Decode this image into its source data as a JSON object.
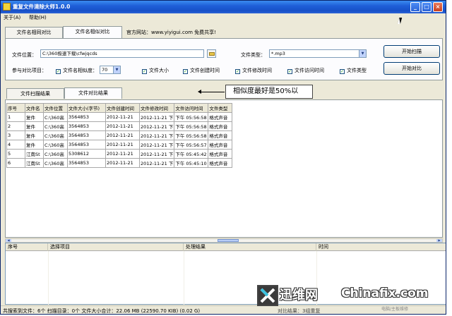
{
  "window": {
    "title": "重复文件清除大师1.0.0",
    "controls": {
      "minimize": "_",
      "maximize": "□",
      "close": "×"
    }
  },
  "menu": {
    "items": [
      "关于(A)",
      "帮助(H)"
    ]
  },
  "top_tabs": {
    "tabs": [
      "文件名相同对比",
      "文件名相似对比"
    ],
    "active_index": 1
  },
  "website": "官方网站：www.yiyigui.com 免费共享!",
  "form": {
    "location_label": "文件位置：",
    "location_value": "C:\\360极速下载\\cfwjqcds",
    "type_label": "文件类型：",
    "type_value": "*.mp3",
    "options_label": "参与对比项目：",
    "similarity_label": "文件名相似度：",
    "similarity_value": "70",
    "checkboxes": [
      "文件大小",
      "文件创建时间",
      "文件修改时间",
      "文件访问时间",
      "文件类型"
    ]
  },
  "buttons": {
    "scan": "开始扫描",
    "compare": "开始对比"
  },
  "result_tabs": {
    "tabs": [
      "文件扫描结果",
      "文件对比结果"
    ],
    "active_index": 1
  },
  "callout": "相似度最好是50%以",
  "table": {
    "headers": [
      "序号",
      "文件名",
      "文件位置",
      "文件大小(字节)",
      "文件创建时间",
      "文件修改时间",
      "文件访问时间",
      "文件类型"
    ],
    "rows": [
      [
        "1",
        "复件",
        "C:\\360高",
        "3564853",
        "2012-11-21",
        "2012-11-21 下",
        "下午 05:56:58",
        "格式声音"
      ],
      [
        "2",
        "复件",
        "C:\\360高",
        "3564853",
        "2012-11-21",
        "2012-11-21 下",
        "下午 05:56:58",
        "格式声音"
      ],
      [
        "3",
        "复件",
        "C:\\360高",
        "3564853",
        "2012-11-21",
        "2012-11-21 下",
        "下午 05:56:58",
        "格式声音"
      ],
      [
        "4",
        "复件",
        "C:\\360高",
        "3564853",
        "2012-11-21",
        "2012-11-21 下",
        "下午 05:56:57",
        "格式声音"
      ],
      [
        "5",
        "江南St",
        "C:\\360高",
        "5308612",
        "2012-11-21",
        "2012-11-21 下",
        "下午 05:45:42",
        "格式声音"
      ],
      [
        "6",
        "江南St",
        "C:\\360高",
        "3564853",
        "2012-11-21",
        "2012-11-21 下",
        "下午 05:45:10",
        "格式声音"
      ]
    ]
  },
  "log": {
    "headers": [
      "序号",
      "选择项目",
      "处理结果",
      "时间"
    ]
  },
  "status": {
    "text": "共搜索到文件：6个   扫描目录：0个   文件大小合计：22.06 MB (22590.70 KIB) (0.02 G)",
    "right": "对比结果：3组重复"
  },
  "watermark": {
    "cn": "迅维网",
    "en": "Chinafix.com",
    "sub": "电脑/主板维修"
  }
}
